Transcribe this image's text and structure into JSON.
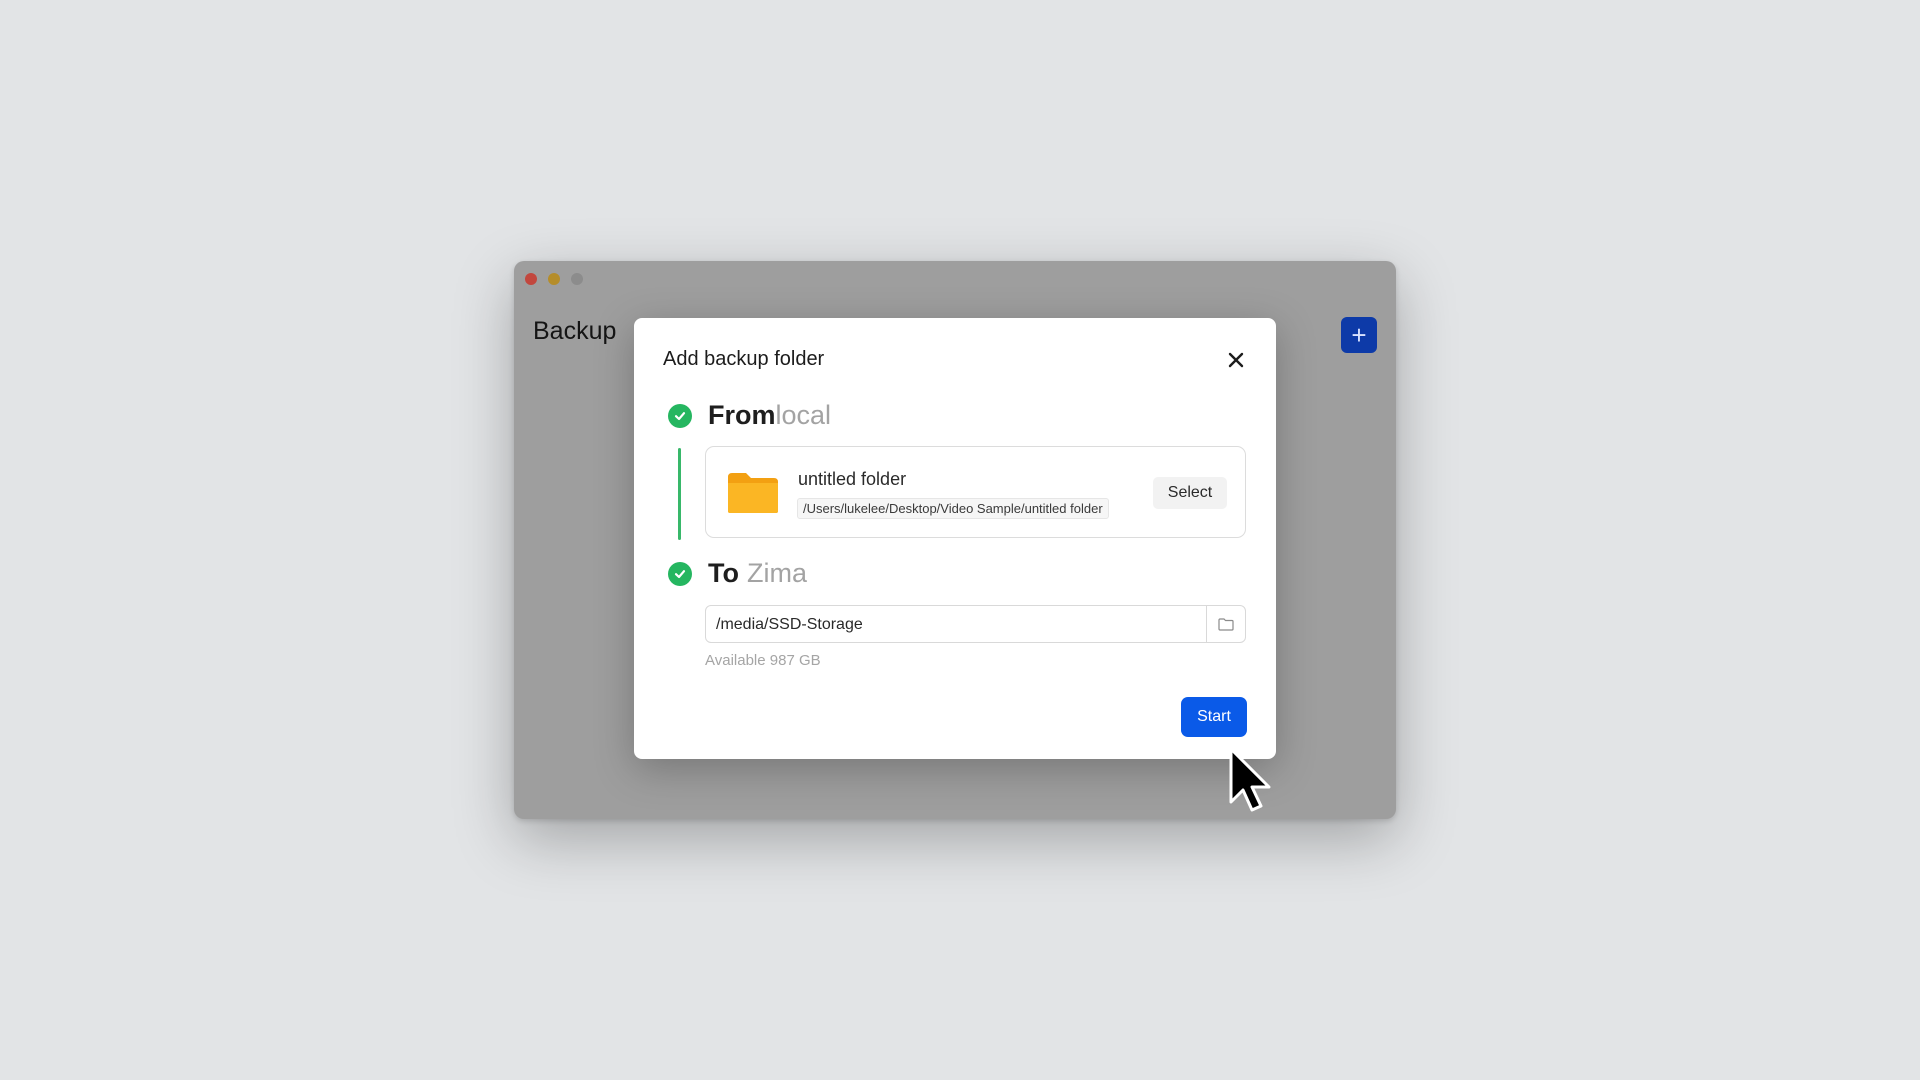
{
  "window": {
    "title": "Backup",
    "add_button_label": "+",
    "add_icon": "plus-icon"
  },
  "modal": {
    "title": "Add backup folder",
    "close_icon": "close-icon",
    "source": {
      "heading_strong": "From",
      "heading_light": "local",
      "folder_name": "untitled folder",
      "folder_path": "/Users/lukelee/Desktop/Video Sample/untitled folder",
      "select_label": "Select",
      "folder_icon": "folder-icon"
    },
    "destination": {
      "heading_strong": "To",
      "heading_light": "Zima",
      "path_value": "/media/SSD-Storage",
      "available_text": "Available 987 GB",
      "browse_icon": "folder-outline-icon"
    },
    "start_label": "Start"
  },
  "colors": {
    "accent": "#0a5ae8",
    "success": "#25b660",
    "folder": "#f5a516"
  }
}
